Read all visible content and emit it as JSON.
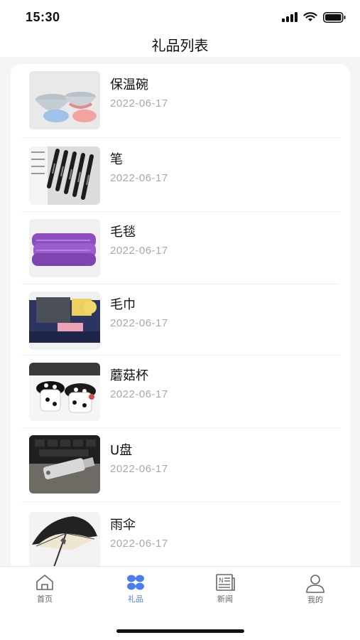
{
  "status_bar": {
    "time": "15:30"
  },
  "header": {
    "title": "礼品列表"
  },
  "gifts": [
    {
      "name": "保温碗",
      "date": "2022-06-17",
      "image": "bowl-image"
    },
    {
      "name": "笔",
      "date": "2022-06-17",
      "image": "pen-image"
    },
    {
      "name": "毛毯",
      "date": "2022-06-17",
      "image": "blanket-image"
    },
    {
      "name": "毛巾",
      "date": "2022-06-17",
      "image": "towel-image"
    },
    {
      "name": "蘑菇杯",
      "date": "2022-06-17",
      "image": "mushroom-cup-image"
    },
    {
      "name": "U盘",
      "date": "2022-06-17",
      "image": "usb-drive-image"
    },
    {
      "name": "雨伞",
      "date": "2022-06-17",
      "image": "umbrella-image"
    }
  ],
  "tab_bar": {
    "active": "礼品",
    "accent_color": "#4a7df0",
    "tabs": [
      {
        "label": "首页",
        "icon": "home-icon"
      },
      {
        "label": "礼品",
        "icon": "gift-grid-icon"
      },
      {
        "label": "新闻",
        "icon": "news-icon"
      },
      {
        "label": "我的",
        "icon": "profile-icon"
      }
    ]
  }
}
